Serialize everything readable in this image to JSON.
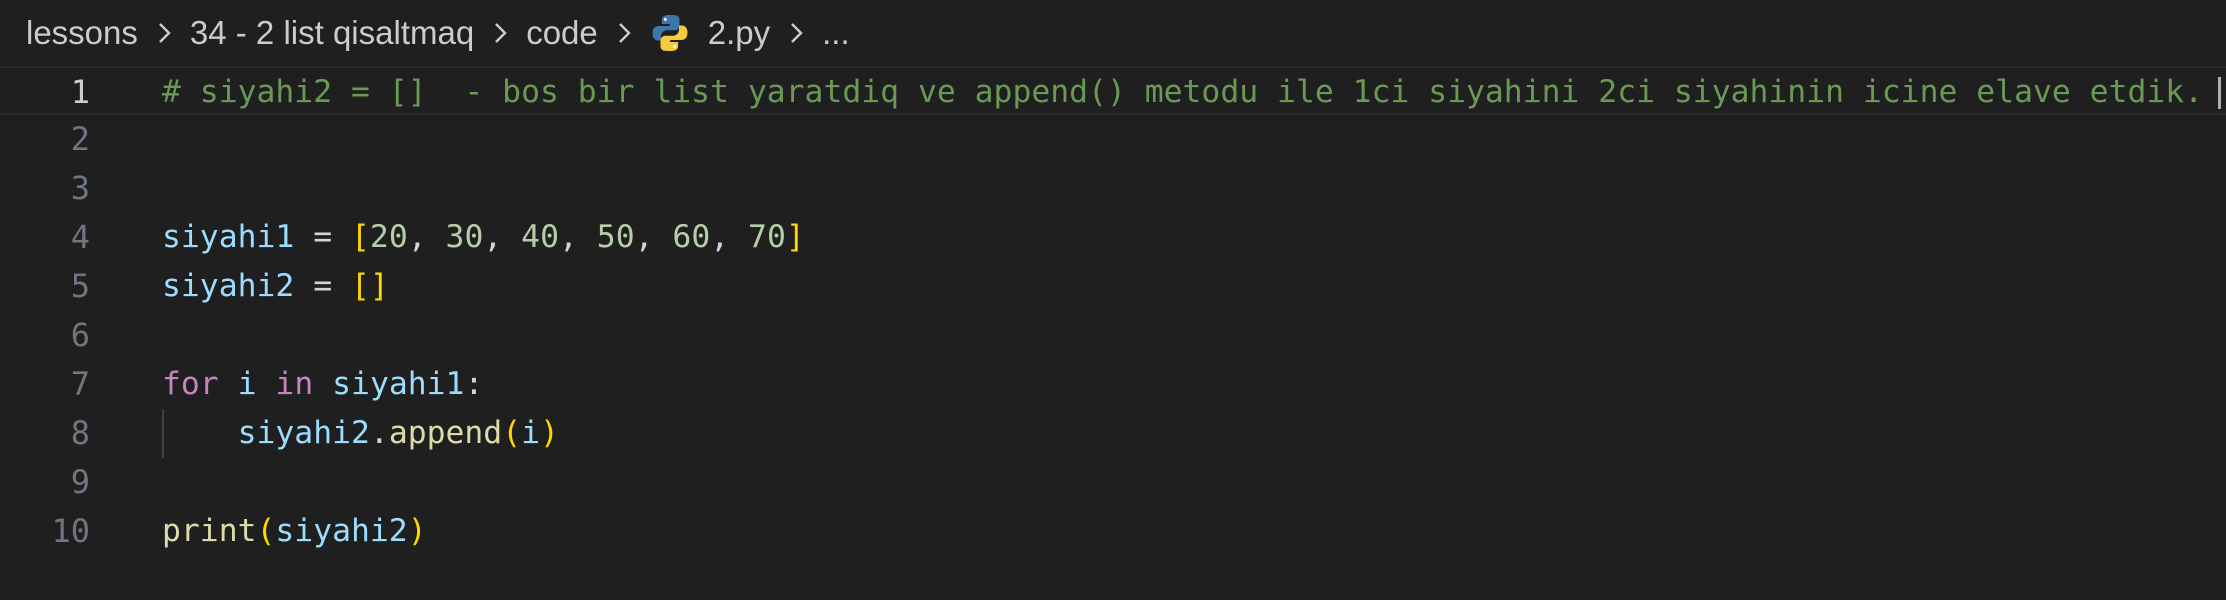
{
  "breadcrumb": {
    "items": [
      "lessons",
      "34 - 2 list qisaltmaq",
      "code",
      "2.py",
      "..."
    ],
    "file_icon": "python-icon"
  },
  "editor": {
    "language": "python",
    "current_line": 1,
    "lines": [
      {
        "number": "1",
        "text": "# siyahi2 = []  - bos bir list yaratdiq ve append() metodu ile 1ci siyahini 2ci siyahinin icine elave etdik."
      },
      {
        "number": "2",
        "text": ""
      },
      {
        "number": "3",
        "text": ""
      },
      {
        "number": "4",
        "text": "siyahi1 = [20, 30, 40, 50, 60, 70]"
      },
      {
        "number": "5",
        "text": "siyahi2 = []"
      },
      {
        "number": "6",
        "text": ""
      },
      {
        "number": "7",
        "text": "for i in siyahi1:"
      },
      {
        "number": "8",
        "text": "    siyahi2.append(i)"
      },
      {
        "number": "9",
        "text": ""
      },
      {
        "number": "10",
        "text": "print(siyahi2)"
      }
    ]
  },
  "colors": {
    "background": "#1f1f1f",
    "comment": "#6a9955",
    "variable": "#9cdcfe",
    "bracket": "#ffd700",
    "number": "#b5cea8",
    "keyword": "#c586c0",
    "function": "#dcdcaa"
  }
}
